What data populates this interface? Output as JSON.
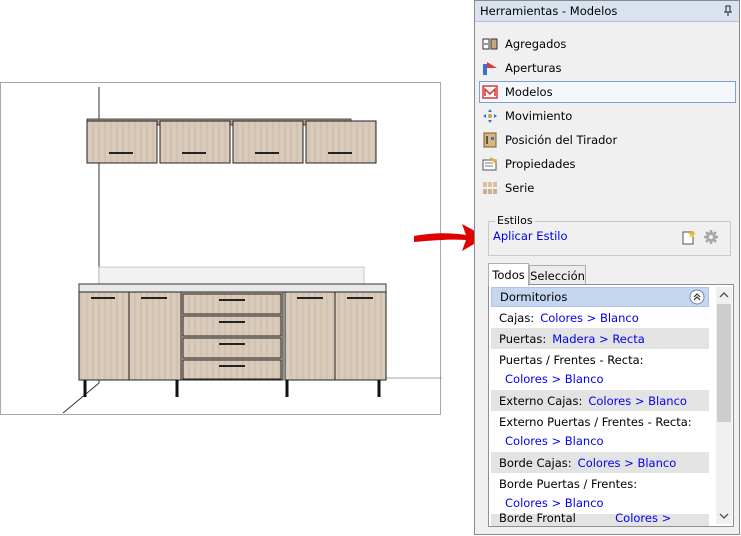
{
  "panel": {
    "title": "Herramientas - Modelos",
    "tools": [
      {
        "label": "Agregados",
        "icon": "aggregates-icon"
      },
      {
        "label": "Aperturas",
        "icon": "openings-icon"
      },
      {
        "label": "Modelos",
        "icon": "models-icon"
      },
      {
        "label": "Movimiento",
        "icon": "move-icon"
      },
      {
        "label": "Posición del Tirador",
        "icon": "handle-position-icon"
      },
      {
        "label": "Propiedades",
        "icon": "properties-icon"
      },
      {
        "label": "Serie",
        "icon": "series-icon"
      }
    ],
    "selected_tool": "Modelos"
  },
  "estilos": {
    "legend": "Estilos",
    "apply_link": "Aplicar Estilo"
  },
  "tabs": [
    {
      "label": "Todos",
      "active": true
    },
    {
      "label": "Selección",
      "active": false
    }
  ],
  "section": {
    "title": "Dormitorios",
    "props": [
      {
        "label": "Cajas:",
        "value": "Colores > Blanco",
        "shade": false,
        "wrap": false
      },
      {
        "label": "Puertas:",
        "value": "Madera > Recta",
        "shade": true,
        "wrap": false
      },
      {
        "label": "Puertas / Frentes - Recta:",
        "value": "Colores > Blanco",
        "shade": false,
        "wrap": true
      },
      {
        "label": "Externo Cajas:",
        "value": "Colores > Blanco",
        "shade": true,
        "wrap": false
      },
      {
        "label": "Externo Puertas / Frentes - Recta:",
        "value": "Colores > Blanco",
        "shade": false,
        "wrap": true
      },
      {
        "label": "Borde Cajas:",
        "value": "Colores > Blanco",
        "shade": true,
        "wrap": false
      },
      {
        "label": "Borde Puertas / Frentes:",
        "value": "Colores > Blanco",
        "shade": false,
        "wrap": true
      },
      {
        "label": "Borde Frontal Cajas:",
        "value": "Colores > Blanco",
        "shade": true,
        "wrap": false
      }
    ]
  },
  "colors": {
    "wood": "#d8c8b8",
    "link": "#0000ee",
    "arrow": "#e00000",
    "title_bar": "#d9e3ef",
    "section_header": "#c5d7ef"
  }
}
